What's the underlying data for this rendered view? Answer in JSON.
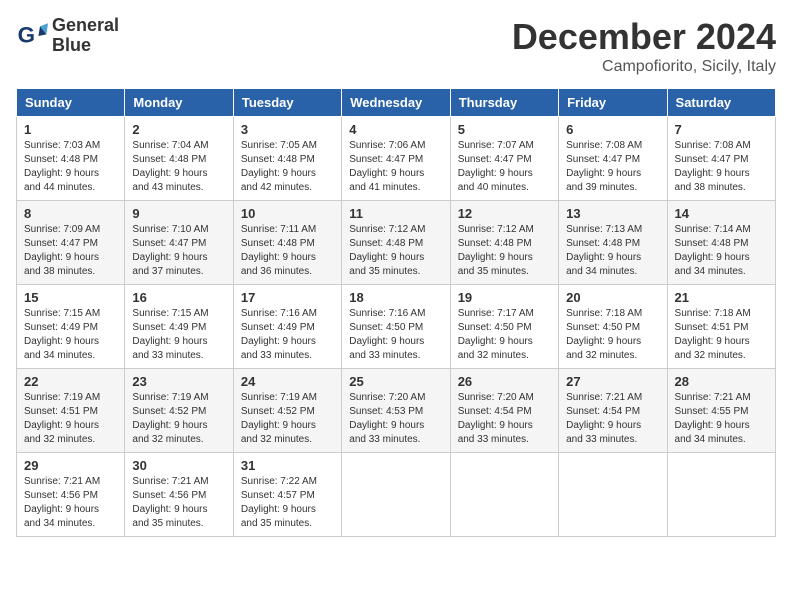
{
  "header": {
    "logo_line1": "General",
    "logo_line2": "Blue",
    "month": "December 2024",
    "location": "Campofiorito, Sicily, Italy"
  },
  "days_of_week": [
    "Sunday",
    "Monday",
    "Tuesday",
    "Wednesday",
    "Thursday",
    "Friday",
    "Saturday"
  ],
  "weeks": [
    [
      {
        "day": 1,
        "sunrise": "7:03 AM",
        "sunset": "4:48 PM",
        "daylight": "9 hours and 44 minutes."
      },
      {
        "day": 2,
        "sunrise": "7:04 AM",
        "sunset": "4:48 PM",
        "daylight": "9 hours and 43 minutes."
      },
      {
        "day": 3,
        "sunrise": "7:05 AM",
        "sunset": "4:48 PM",
        "daylight": "9 hours and 42 minutes."
      },
      {
        "day": 4,
        "sunrise": "7:06 AM",
        "sunset": "4:47 PM",
        "daylight": "9 hours and 41 minutes."
      },
      {
        "day": 5,
        "sunrise": "7:07 AM",
        "sunset": "4:47 PM",
        "daylight": "9 hours and 40 minutes."
      },
      {
        "day": 6,
        "sunrise": "7:08 AM",
        "sunset": "4:47 PM",
        "daylight": "9 hours and 39 minutes."
      },
      {
        "day": 7,
        "sunrise": "7:08 AM",
        "sunset": "4:47 PM",
        "daylight": "9 hours and 38 minutes."
      }
    ],
    [
      {
        "day": 8,
        "sunrise": "7:09 AM",
        "sunset": "4:47 PM",
        "daylight": "9 hours and 38 minutes."
      },
      {
        "day": 9,
        "sunrise": "7:10 AM",
        "sunset": "4:47 PM",
        "daylight": "9 hours and 37 minutes."
      },
      {
        "day": 10,
        "sunrise": "7:11 AM",
        "sunset": "4:48 PM",
        "daylight": "9 hours and 36 minutes."
      },
      {
        "day": 11,
        "sunrise": "7:12 AM",
        "sunset": "4:48 PM",
        "daylight": "9 hours and 35 minutes."
      },
      {
        "day": 12,
        "sunrise": "7:12 AM",
        "sunset": "4:48 PM",
        "daylight": "9 hours and 35 minutes."
      },
      {
        "day": 13,
        "sunrise": "7:13 AM",
        "sunset": "4:48 PM",
        "daylight": "9 hours and 34 minutes."
      },
      {
        "day": 14,
        "sunrise": "7:14 AM",
        "sunset": "4:48 PM",
        "daylight": "9 hours and 34 minutes."
      }
    ],
    [
      {
        "day": 15,
        "sunrise": "7:15 AM",
        "sunset": "4:49 PM",
        "daylight": "9 hours and 34 minutes."
      },
      {
        "day": 16,
        "sunrise": "7:15 AM",
        "sunset": "4:49 PM",
        "daylight": "9 hours and 33 minutes."
      },
      {
        "day": 17,
        "sunrise": "7:16 AM",
        "sunset": "4:49 PM",
        "daylight": "9 hours and 33 minutes."
      },
      {
        "day": 18,
        "sunrise": "7:16 AM",
        "sunset": "4:50 PM",
        "daylight": "9 hours and 33 minutes."
      },
      {
        "day": 19,
        "sunrise": "7:17 AM",
        "sunset": "4:50 PM",
        "daylight": "9 hours and 32 minutes."
      },
      {
        "day": 20,
        "sunrise": "7:18 AM",
        "sunset": "4:50 PM",
        "daylight": "9 hours and 32 minutes."
      },
      {
        "day": 21,
        "sunrise": "7:18 AM",
        "sunset": "4:51 PM",
        "daylight": "9 hours and 32 minutes."
      }
    ],
    [
      {
        "day": 22,
        "sunrise": "7:19 AM",
        "sunset": "4:51 PM",
        "daylight": "9 hours and 32 minutes."
      },
      {
        "day": 23,
        "sunrise": "7:19 AM",
        "sunset": "4:52 PM",
        "daylight": "9 hours and 32 minutes."
      },
      {
        "day": 24,
        "sunrise": "7:19 AM",
        "sunset": "4:52 PM",
        "daylight": "9 hours and 32 minutes."
      },
      {
        "day": 25,
        "sunrise": "7:20 AM",
        "sunset": "4:53 PM",
        "daylight": "9 hours and 33 minutes."
      },
      {
        "day": 26,
        "sunrise": "7:20 AM",
        "sunset": "4:54 PM",
        "daylight": "9 hours and 33 minutes."
      },
      {
        "day": 27,
        "sunrise": "7:21 AM",
        "sunset": "4:54 PM",
        "daylight": "9 hours and 33 minutes."
      },
      {
        "day": 28,
        "sunrise": "7:21 AM",
        "sunset": "4:55 PM",
        "daylight": "9 hours and 34 minutes."
      }
    ],
    [
      {
        "day": 29,
        "sunrise": "7:21 AM",
        "sunset": "4:56 PM",
        "daylight": "9 hours and 34 minutes."
      },
      {
        "day": 30,
        "sunrise": "7:21 AM",
        "sunset": "4:56 PM",
        "daylight": "9 hours and 35 minutes."
      },
      {
        "day": 31,
        "sunrise": "7:22 AM",
        "sunset": "4:57 PM",
        "daylight": "9 hours and 35 minutes."
      },
      null,
      null,
      null,
      null
    ]
  ]
}
